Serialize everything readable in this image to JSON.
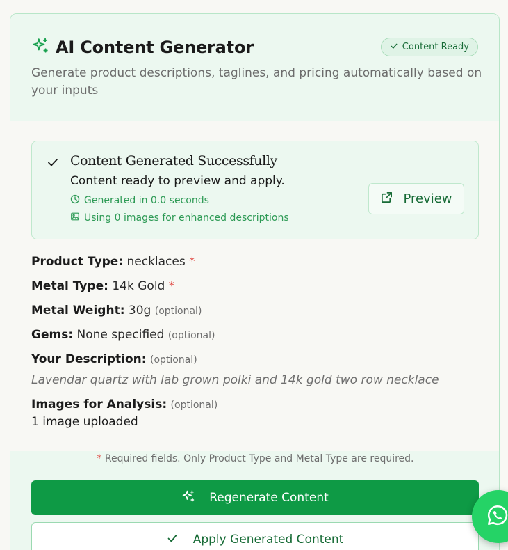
{
  "header": {
    "title": "AI Content Generator",
    "badge": "Content Ready",
    "subtitle": "Generate product descriptions, taglines, and pricing automatically based on your inputs"
  },
  "success": {
    "title": "Content Generated Successfully",
    "subtitle": "Content ready to preview and apply.",
    "time": "Generated in 0.0 seconds",
    "images": "Using 0 images for enhanced descriptions",
    "preview_label": "Preview"
  },
  "fields": {
    "product_type": {
      "label": "Product Type:",
      "value": "necklaces",
      "required": "*"
    },
    "metal_type": {
      "label": "Metal Type:",
      "value": "14k Gold",
      "required": "*"
    },
    "metal_weight": {
      "label": "Metal Weight:",
      "value": "30g",
      "optional": "(optional)"
    },
    "gems": {
      "label": "Gems:",
      "value": "None specified",
      "optional": "(optional)"
    },
    "description": {
      "label": "Your Description:",
      "optional": "(optional)",
      "value": "Lavendar quartz with lab grown polki and 14k gold two row necklace"
    },
    "images": {
      "label": "Images for Analysis:",
      "optional": "(optional)",
      "value": "1 image uploaded"
    }
  },
  "footer": {
    "required_star": "*",
    "required_note": "Required fields. Only Product Type and Metal Type are required.",
    "regenerate_label": "Regenerate Content",
    "apply_label": "Apply Generated Content"
  },
  "colors": {
    "accent": "#0e9a45",
    "accent_dark": "#176b36",
    "success_bg": "#ecf8f0",
    "required": "#e0403a",
    "whatsapp": "#25d366"
  },
  "icons": {
    "title": "sparkles-icon",
    "badge": "check-icon",
    "success": "check-icon",
    "time": "clock-icon",
    "images": "image-icon",
    "preview": "external-link-icon",
    "regenerate": "sparkles-icon",
    "apply": "check-icon",
    "chat": "whatsapp-icon"
  }
}
